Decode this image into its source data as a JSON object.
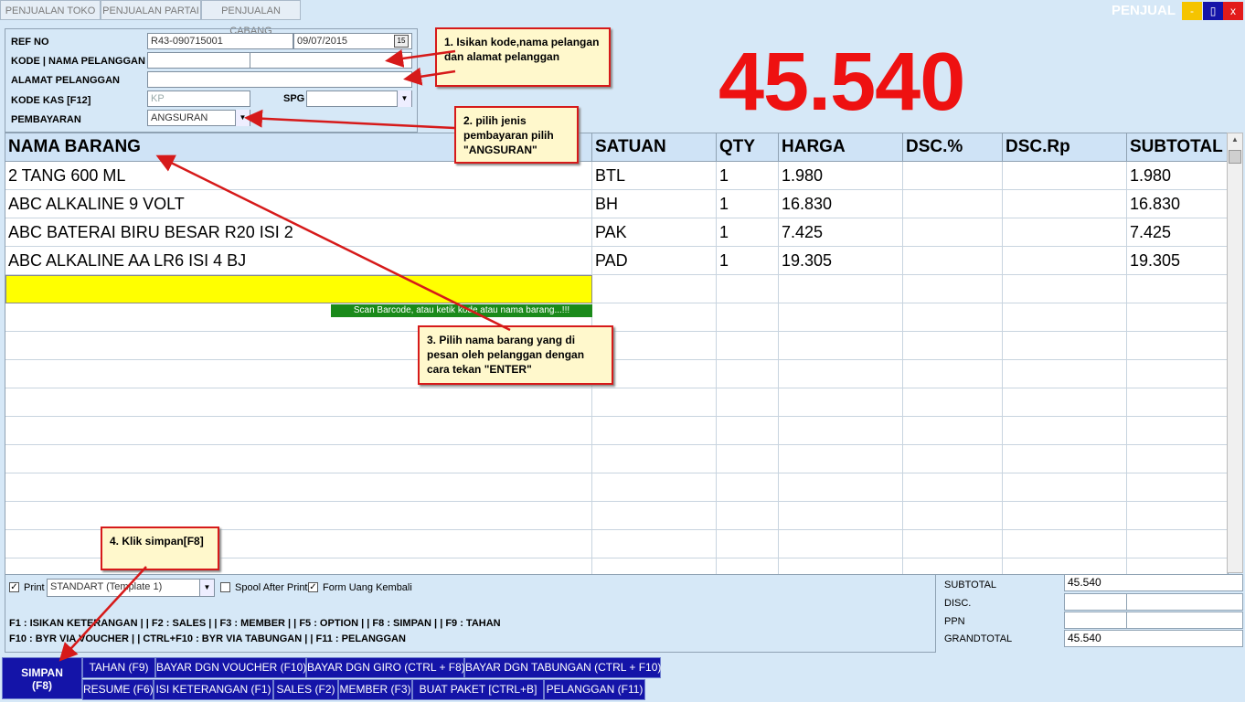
{
  "tabs": [
    "PENJUALAN TOKO",
    "PENJUALAN PARTAI",
    "PENJUALAN CABANG"
  ],
  "window": {
    "title": "PENJUAL",
    "min": "-",
    "max": "▯",
    "close": "x"
  },
  "form": {
    "ref_no_label": "REF NO",
    "ref_no": "R43-090715001",
    "date": "09/07/2015",
    "calendar_glyph": "15",
    "pelanggan_label": "KODE | NAMA PELANGGAN",
    "alamat_label": "ALAMAT PELANGGAN",
    "kas_label": "KODE KAS [F12]",
    "kas_placeholder": "KP",
    "spg_label": "SPG",
    "pembayaran_label": "PEMBAYARAN",
    "pembayaran_value": "ANGSURAN"
  },
  "total_display": "45.540",
  "table": {
    "headers": [
      "NAMA BARANG",
      "SATUAN",
      "QTY",
      "HARGA",
      "DSC.%",
      "DSC.Rp",
      "SUBTOTAL"
    ],
    "rows": [
      [
        "2 TANG 600 ML",
        "BTL",
        "1",
        "1.980",
        "",
        "",
        "1.980"
      ],
      [
        "ABC ALKALINE 9 VOLT",
        "BH",
        "1",
        "16.830",
        "",
        "",
        "16.830"
      ],
      [
        "ABC BATERAI BIRU BESAR R20 ISI 2",
        "PAK",
        "1",
        "7.425",
        "",
        "",
        "7.425"
      ],
      [
        "ABC ALKALINE AA LR6 ISI 4 BJ",
        "PAD",
        "1",
        "19.305",
        "",
        "",
        "19.305"
      ]
    ],
    "scan_hint": "Scan Barcode, atau ketik kode atau nama barang...!!!"
  },
  "options": {
    "print_label": "Print",
    "template_value": "STANDART (Template 1)",
    "spool_label": "Spool After Print",
    "form_uang_label": "Form Uang Kembali"
  },
  "help_lines": [
    "F1 : ISIKAN KETERANGAN | | F2 : SALES | | F3 : MEMBER | | F5 : OPTION  | | F8 : SIMPAN | | F9 : TAHAN",
    "F10 : BYR VIA VOUCHER | | CTRL+F10 : BYR VIA TABUNGAN  | | F11 : PELANGGAN"
  ],
  "summary": {
    "subtotal_label": "SUBTOTAL",
    "subtotal": "45.540",
    "disc_label": "DISC.",
    "ppn_label": "PPN",
    "grandtotal_label": "GRANDTOTAL",
    "grandtotal": "45.540"
  },
  "buttons": {
    "simpan": "SIMPAN",
    "simpan_key": "(F8)",
    "row1": [
      "TAHAN (F9)",
      "BAYAR DGN VOUCHER (F10)",
      "BAYAR DGN GIRO (CTRL + F8)",
      "BAYAR DGN TABUNGAN (CTRL + F10)"
    ],
    "row2": [
      "RESUME (F6)",
      "ISI KETERANGAN (F1)",
      "SALES (F2)",
      "MEMBER (F3)",
      "BUAT PAKET [CTRL+B]",
      "PELANGGAN (F11)"
    ]
  },
  "annotations": {
    "a1": "1. Isikan kode,nama pelangan dan alamat pelanggan",
    "a2": "2. pilih jenis pembayaran pilih \"ANGSURAN\"",
    "a3": "3. Pilih nama barang yang di pesan oleh pelanggan dengan cara tekan \"ENTER\"",
    "a4": "4. Klik simpan[F8]"
  },
  "colors": {
    "accent_red": "#ee1111",
    "button_blue": "#1414a8",
    "input_yellow": "#ffff00",
    "hint_green": "#1a8a1a"
  }
}
